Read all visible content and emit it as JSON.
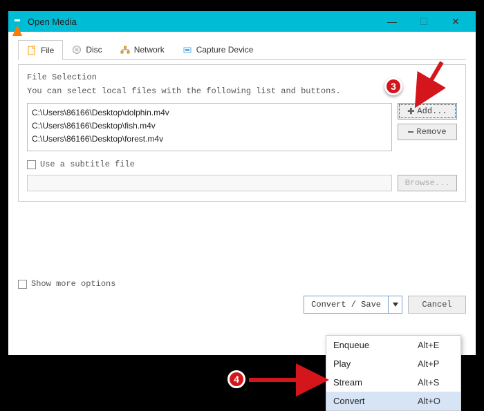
{
  "window": {
    "title": "Open Media"
  },
  "tabs": [
    {
      "label": "File"
    },
    {
      "label": "Disc"
    },
    {
      "label": "Network"
    },
    {
      "label": "Capture Device"
    }
  ],
  "file_selection": {
    "legend": "File Selection",
    "hint": "You can select local files with the following list and buttons.",
    "files": [
      "C:\\Users\\86166\\Desktop\\dolphin.m4v",
      "C:\\Users\\86166\\Desktop\\fish.m4v",
      "C:\\Users\\86166\\Desktop\\forest.m4v"
    ],
    "add_label": "Add...",
    "remove_label": "Remove"
  },
  "subtitle": {
    "checkbox_label": "Use a subtitle file",
    "browse_label": "Browse..."
  },
  "show_more_label": "Show more options",
  "footer": {
    "convert_save_label": "Convert / Save",
    "cancel_label": "Cancel"
  },
  "menu": {
    "items": [
      {
        "label": "Enqueue",
        "shortcut": "Alt+E"
      },
      {
        "label": "Play",
        "shortcut": "Alt+P"
      },
      {
        "label": "Stream",
        "shortcut": "Alt+S"
      },
      {
        "label": "Convert",
        "shortcut": "Alt+O"
      }
    ]
  },
  "annotations": {
    "badge3": "3",
    "badge4": "4"
  }
}
